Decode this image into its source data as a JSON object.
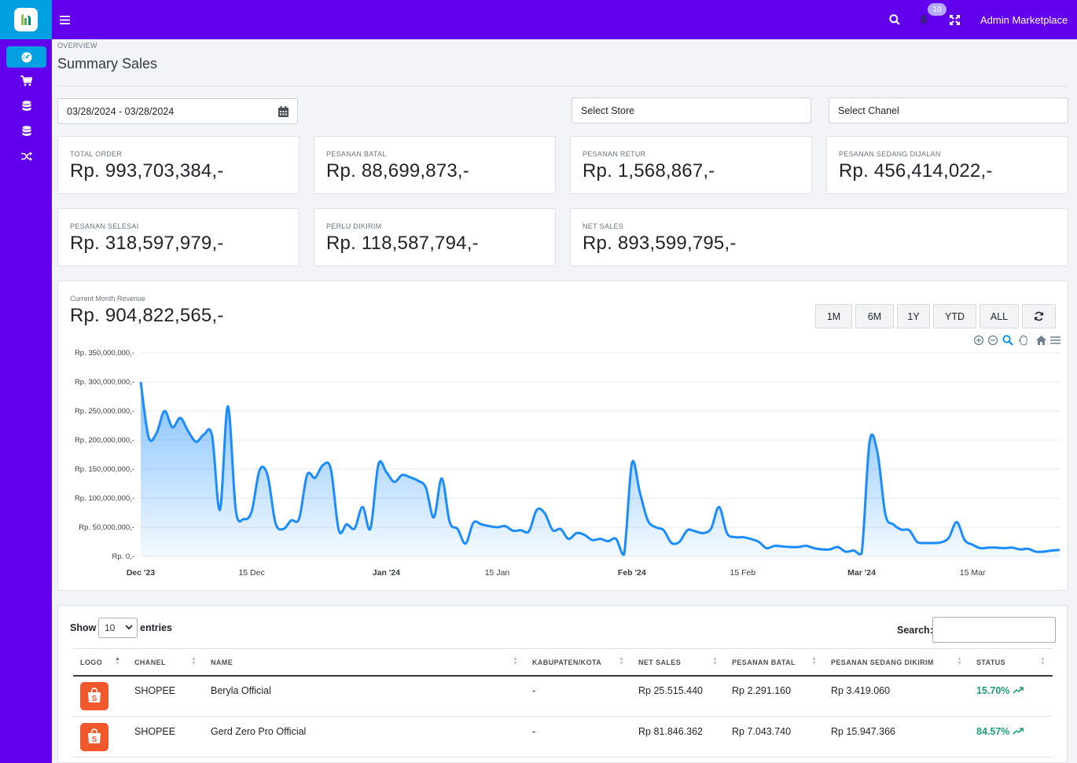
{
  "app": {
    "user_label": "Admin Marketplace",
    "notification_count": "10",
    "brand_color": "#6200ee",
    "accent_color": "#00a0e3"
  },
  "sidebar": {
    "items": [
      {
        "icon": "dashboard-icon",
        "active": true
      },
      {
        "icon": "cart-icon"
      },
      {
        "icon": "database-icon"
      },
      {
        "icon": "database-icon"
      },
      {
        "icon": "shuffle-icon"
      }
    ]
  },
  "page": {
    "section": "OVERVIEW",
    "title": "Summary Sales"
  },
  "filters": {
    "date_range": "03/28/2024 - 03/28/2024",
    "store": "Select Store",
    "channel": "Select Chanel"
  },
  "stats": [
    {
      "label": "TOTAL ORDER",
      "value": "Rp. 993,703,384,-"
    },
    {
      "label": "PESANAN BATAL",
      "value": "Rp. 88,699,873,-"
    },
    {
      "label": "PESANAN RETUR",
      "value": "Rp. 1,568,867,-"
    },
    {
      "label": "PESANAN SEDANG DIJALAN",
      "value": "Rp. 456,414,022,-"
    },
    {
      "label": "PESANAN SELESAI",
      "value": "Rp. 318,597,979,-"
    },
    {
      "label": "PERLU DIKIRIM",
      "value": "Rp. 118,587,794,-"
    },
    {
      "label": "NET SALES",
      "value": "Rp. 893,599,795,-"
    }
  ],
  "revenue": {
    "label": "Current Month Revenue",
    "value": "Rp. 904,822,565,-",
    "ranges": [
      "1M",
      "6M",
      "1Y",
      "YTD",
      "ALL"
    ]
  },
  "chart_data": {
    "type": "area",
    "title": "",
    "xlabel": "",
    "ylabel": "",
    "ylim": [
      0,
      350000000
    ],
    "grid": true,
    "y_ticks": [
      "Rp. 0,-",
      "Rp. 50,000,000,-",
      "Rp. 100,000,000,-",
      "Rp. 150,000,000,-",
      "Rp. 200,000,000,-",
      "Rp. 250,000,000,-",
      "Rp. 300,000,000,-",
      "Rp. 350,000,000,-"
    ],
    "x_ticks": [
      {
        "label": "Dec '23",
        "day": 0,
        "bold": true
      },
      {
        "label": "15 Dec",
        "day": 14
      },
      {
        "label": "Jan '24",
        "day": 31,
        "bold": true
      },
      {
        "label": "15 Jan",
        "day": 45
      },
      {
        "label": "Feb '24",
        "day": 62,
        "bold": true
      },
      {
        "label": "15 Feb",
        "day": 76
      },
      {
        "label": "Mar '24",
        "day": 91,
        "bold": true
      },
      {
        "label": "15 Mar",
        "day": 105
      }
    ],
    "series": [
      {
        "color": "#1a8cff",
        "values": [
          300000000,
          205000000,
          212000000,
          250000000,
          222000000,
          238000000,
          215000000,
          197000000,
          210000000,
          208000000,
          80000000,
          258000000,
          80000000,
          64000000,
          77000000,
          148000000,
          140000000,
          58000000,
          47000000,
          62000000,
          65000000,
          140000000,
          135000000,
          157000000,
          150000000,
          45000000,
          55000000,
          48000000,
          85000000,
          48000000,
          158000000,
          145000000,
          128000000,
          140000000,
          136000000,
          130000000,
          118000000,
          67000000,
          134000000,
          59000000,
          47000000,
          22000000,
          58000000,
          55000000,
          52000000,
          50000000,
          52000000,
          44000000,
          45000000,
          43000000,
          80000000,
          74000000,
          45000000,
          47000000,
          30000000,
          40000000,
          37000000,
          28000000,
          30000000,
          26000000,
          30000000,
          3000000,
          160000000,
          110000000,
          62000000,
          50000000,
          45000000,
          23000000,
          25000000,
          45000000,
          43000000,
          40000000,
          48000000,
          85000000,
          40000000,
          33000000,
          33000000,
          30000000,
          25000000,
          14000000,
          18000000,
          17000000,
          16000000,
          16000000,
          18000000,
          14000000,
          12000000,
          12000000,
          16000000,
          8000000,
          10000000,
          5000000,
          197000000,
          178000000,
          72000000,
          55000000,
          46000000,
          45000000,
          25000000,
          23000000,
          23000000,
          24000000,
          32000000,
          59000000,
          28000000,
          20000000,
          14000000,
          15000000,
          15000000,
          14000000,
          15000000,
          12000000,
          13000000,
          8000000,
          8000000,
          10000000,
          11000000
        ]
      }
    ]
  },
  "table": {
    "show_label": "Show",
    "entries_label": "entries",
    "page_size": "10",
    "search_label": "Search:",
    "columns": [
      "LOGO",
      "CHANEL",
      "NAME",
      "KABUPATEN/KOTA",
      "NET SALES",
      "PESANAN BATAL",
      "PESANAN SEDANG DIKIRIM",
      "STATUS"
    ],
    "rows": [
      {
        "channel": "SHOPEE",
        "name": "Beryla Official",
        "city": "-",
        "net_sales": "Rp 25.515.440",
        "batal": "Rp 2.291.160",
        "dikirim": "Rp 3.419.060",
        "status": "15.70%"
      },
      {
        "channel": "SHOPEE",
        "name": "Gerd Zero Pro Official",
        "city": "-",
        "net_sales": "Rp 81.846.362",
        "batal": "Rp 7.043.740",
        "dikirim": "Rp 15.947.366",
        "status": "84.57%"
      }
    ]
  }
}
